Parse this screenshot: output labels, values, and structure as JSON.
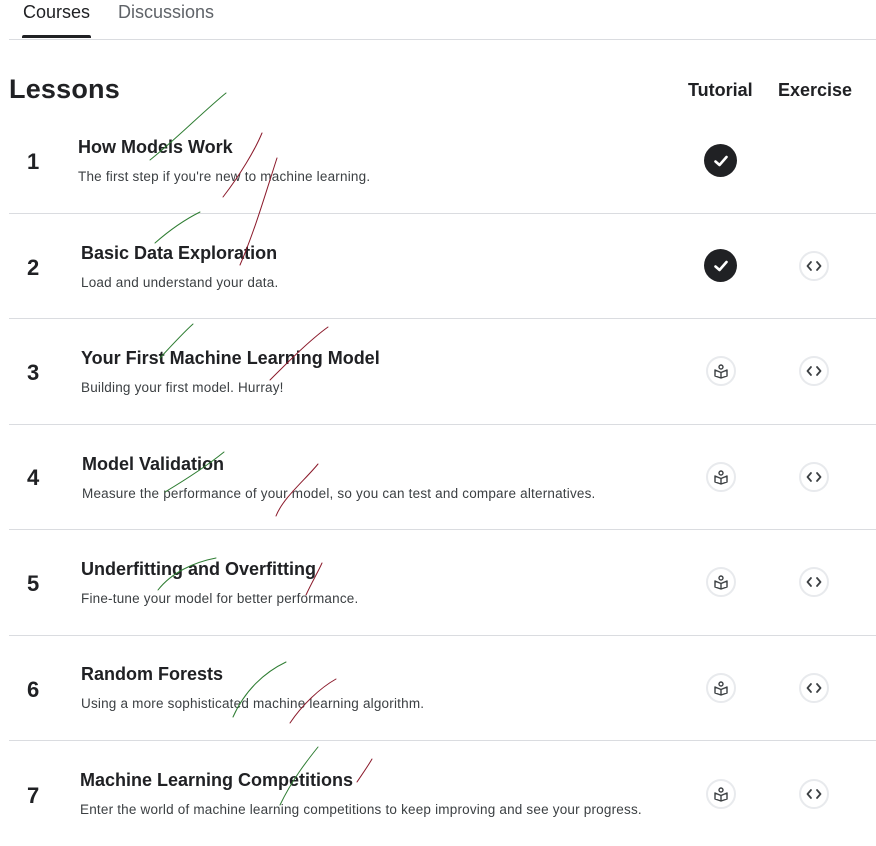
{
  "tabs": {
    "courses": "Courses",
    "discussions": "Discussions"
  },
  "heading": "Lessons",
  "columns": {
    "tutorial": "Tutorial",
    "exercise": "Exercise"
  },
  "lessons": [
    {
      "num": "1",
      "title": "How Models Work",
      "desc": "The first step if you're new to machine learning.",
      "tutorial": "completed",
      "exercise": "none"
    },
    {
      "num": "2",
      "title": "Basic Data Exploration",
      "desc": "Load and understand your data.",
      "tutorial": "completed",
      "exercise": "code"
    },
    {
      "num": "3",
      "title": "Your First Machine Learning Model",
      "desc": "Building your first model. Hurray!",
      "tutorial": "book",
      "exercise": "code"
    },
    {
      "num": "4",
      "title": "Model Validation",
      "desc": "Measure the performance of your model, so you can test and compare alternatives.",
      "tutorial": "book",
      "exercise": "code"
    },
    {
      "num": "5",
      "title": "Underfitting and Overfitting",
      "desc": "Fine-tune your model for better performance.",
      "tutorial": "book",
      "exercise": "code"
    },
    {
      "num": "6",
      "title": "Random Forests",
      "desc": "Using a more sophisticated machine learning algorithm.",
      "tutorial": "book",
      "exercise": "code"
    },
    {
      "num": "7",
      "title": "Machine Learning Competitions",
      "desc": "Enter the world of machine learning competitions to keep improving and see your progress.",
      "tutorial": "book",
      "exercise": "code"
    }
  ],
  "icons": {
    "completed": "check-circle-icon",
    "book": "book-open-icon",
    "code": "code-brackets-icon"
  }
}
